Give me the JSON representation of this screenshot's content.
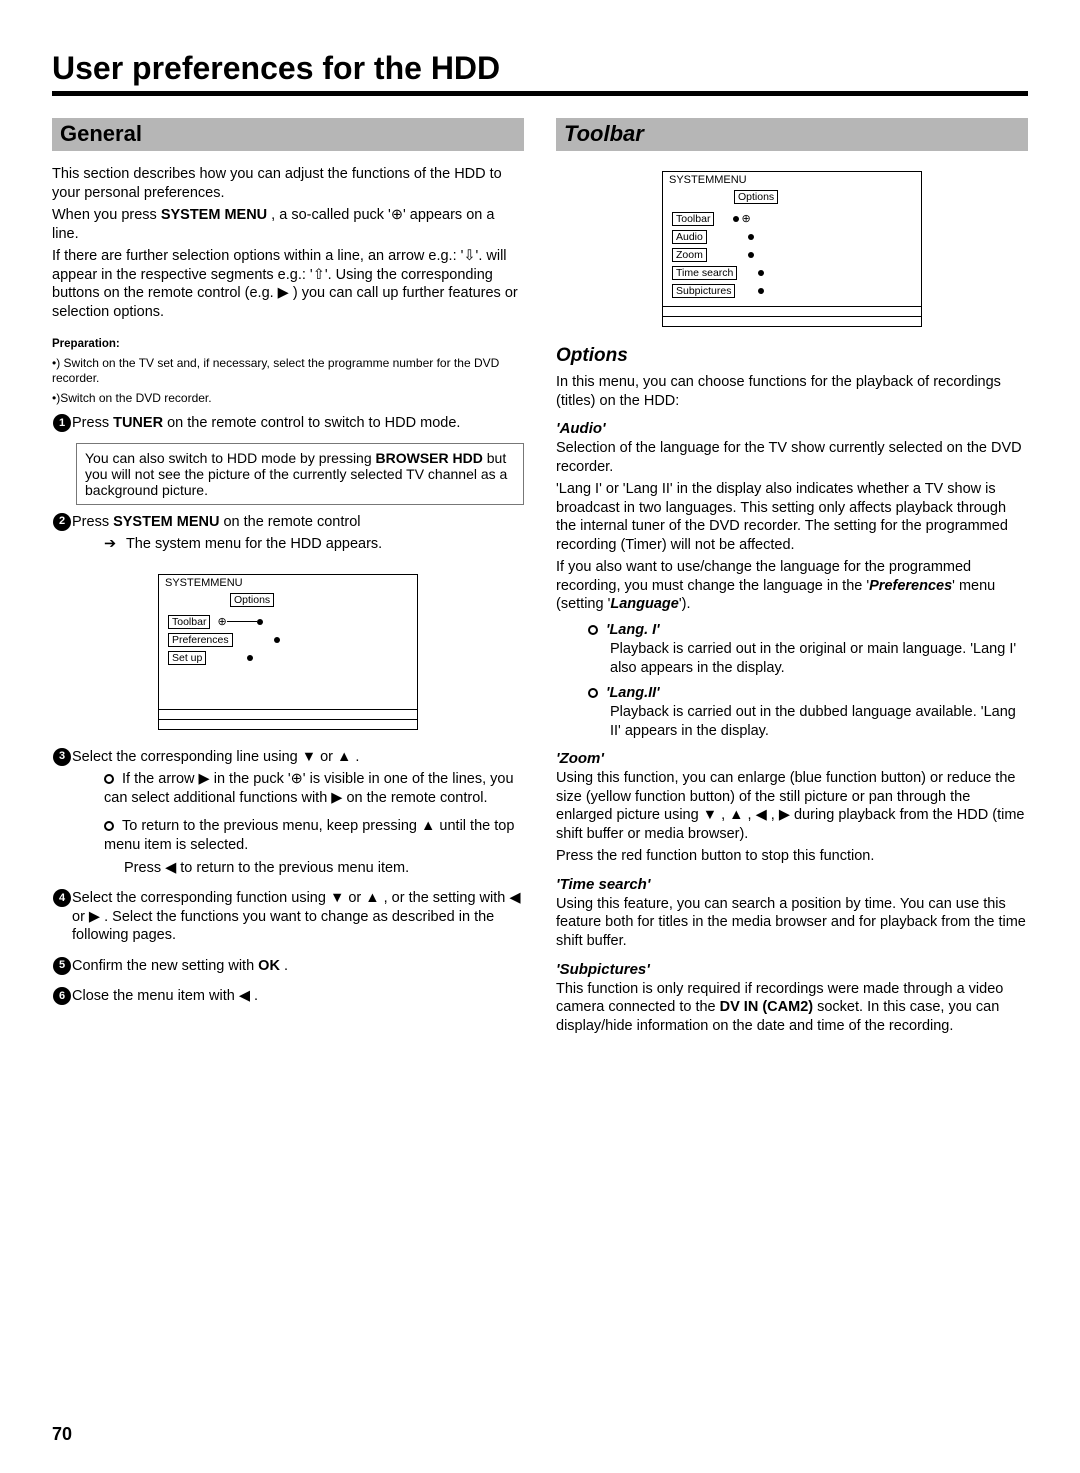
{
  "title": "User preferences for the HDD",
  "pageNumber": "70",
  "left": {
    "heading": "General",
    "intro1": "This section describes how you can adjust the functions of the HDD to your personal preferences.",
    "intro2a": "When you press ",
    "intro2b": "SYSTEM MENU",
    "intro2c": " , a so-called puck '",
    "intro2d": "' appears on a line.",
    "intro3": "If there are further selection options within a line, an arrow e.g.: '⇩'. will appear in the respective segments e.g.: '⇧'. Using the corresponding buttons on the remote control (e.g. ▶ ) you can call up further features or selection options.",
    "prepTitle": "Preparation:",
    "prep1": "•) Switch on the TV set and, if necessary, select the programme number for the DVD recorder.",
    "prep2": "•)Switch on the DVD recorder.",
    "step1a": "Press ",
    "step1b": "TUNER",
    "step1c": " on the remote control to switch to HDD mode.",
    "note1a": "You can also switch to HDD mode by pressing ",
    "note1b": "BROWSER HDD",
    "note1c": " but you will not see the picture of the currently selected TV channel as a background picture.",
    "step2a": "Press ",
    "step2b": "SYSTEM MENU",
    "step2c": " on the remote control",
    "step2sub": "The system menu for the HDD appears.",
    "menu1": {
      "title": "SYSTEMMENU",
      "col": "Options",
      "items": [
        "Toolbar",
        "Preferences",
        "Set up"
      ]
    },
    "step3a": "Select the corresponding line using ▼ or ▲ .",
    "step3o1": "If the arrow ▶ in the puck '⊕' is visible in one of the lines, you can select additional functions with ▶ on the remote control.",
    "step3o2": "To return to the previous menu, keep pressing ▲ until the top menu item is selected.",
    "step3o2b": "Press ◀ to return to the previous menu item.",
    "step4": "Select the corresponding function using ▼ or ▲ , or the setting with ◀ or ▶ . Select the functions you want to change as described in the following pages.",
    "step5a": "Confirm the new setting with ",
    "step5b": "OK",
    "step5c": " .",
    "step6": "Close the menu item with ◀ ."
  },
  "right": {
    "heading": "Toolbar",
    "menu2": {
      "title": "SYSTEMMENU",
      "col": "Options",
      "items": [
        "Toolbar",
        "Audio",
        "Zoom",
        "Time search",
        "Subpictures"
      ]
    },
    "optionsHead": "Options",
    "optionsIntro": "In this menu, you can choose functions for the playback of recordings (titles) on the HDD:",
    "audio": {
      "title": "'Audio'",
      "p1": "Selection of the language for the TV show currently selected on the DVD recorder.",
      "p2": "'Lang I' or 'Lang II' in the display also indicates whether a TV show is broadcast in two languages. This setting only affects playback through the internal tuner of the DVD recorder. The setting for the programmed recording (Timer) will not be affected.",
      "p3a": "If you also want to use/change the language for the programmed recording, you must change the language in the '",
      "p3b": "Preferences",
      "p3c": "' menu (setting '",
      "p3d": "Language",
      "p3e": "').",
      "lang1t": "'Lang. I'",
      "lang1d": "Playback is carried out in the original or main language. 'Lang I' also appears in the display.",
      "lang2t": "'Lang.II'",
      "lang2d": "Playback is carried out in the dubbed language available. 'Lang II' appears in the display."
    },
    "zoom": {
      "title": "'Zoom'",
      "p1": "Using this function, you can enlarge (blue function button) or reduce the size (yellow function button) of the still picture or pan through the enlarged picture using ▼ , ▲ , ◀ , ▶ during playback from the HDD (time shift buffer or media browser).",
      "p2": "Press the red function button to stop this function."
    },
    "timesearch": {
      "title": "'Time search'",
      "p": "Using this feature, you can search a position by time. You can use this feature both for titles in the media browser and for playback from the time shift buffer."
    },
    "subpictures": {
      "title": "'Subpictures'",
      "p1a": "This function is only required if recordings were made through a video camera connected to the ",
      "p1b": "DV IN (CAM2)",
      "p1c": " socket. In this case, you can display/hide information on the date and time of the recording."
    }
  }
}
